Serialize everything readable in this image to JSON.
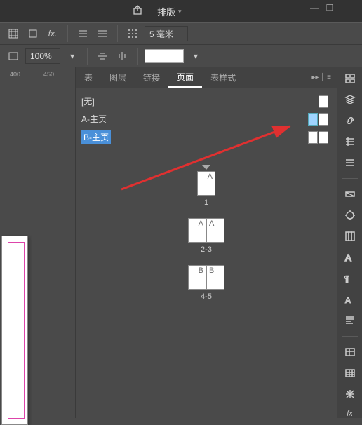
{
  "topbar": {
    "dropdown_label": "排版"
  },
  "toolbar": {
    "indent_value": "5 毫米",
    "zoom_value": "100%"
  },
  "ruler": {
    "tick1": "400",
    "tick2": "450"
  },
  "panel": {
    "tabs": [
      "表",
      "图层",
      "链接",
      "页面",
      "表样式"
    ],
    "active_tab": 3
  },
  "masters": {
    "none": "[无]",
    "a": "A-主页",
    "b": "B-主页"
  },
  "pages": [
    {
      "letters": [
        "A"
      ],
      "label": "1"
    },
    {
      "letters": [
        "A",
        "A"
      ],
      "label": "2-3"
    },
    {
      "letters": [
        "B",
        "B"
      ],
      "label": "4-5"
    }
  ]
}
